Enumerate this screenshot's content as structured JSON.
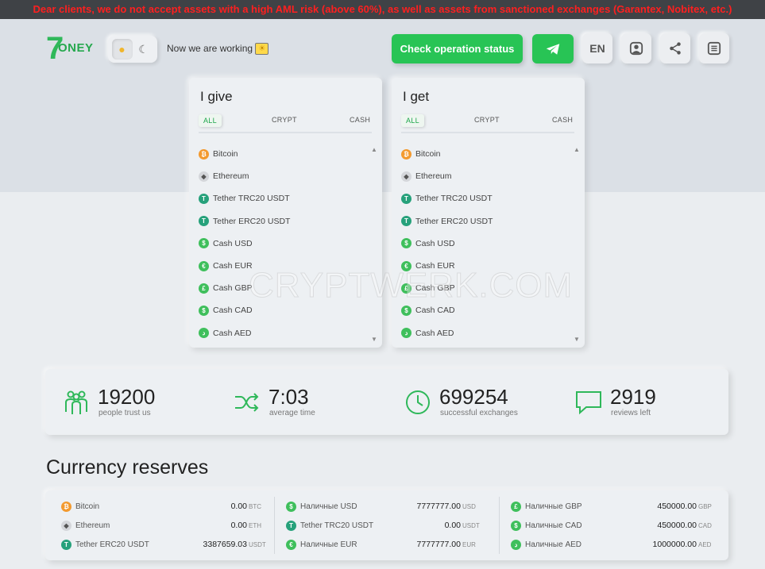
{
  "banner": "Dear clients, we do not accept assets with a high AML risk (above 60%), as well as assets from sanctioned exchanges (Garantex, Nobitex, etc.)",
  "header": {
    "logo_seven": "7",
    "logo_text": "ONEY",
    "working_text": "Now we are working",
    "check_status_label": "Check operation status",
    "lang_label": "EN"
  },
  "give": {
    "title": "I give",
    "tabs": [
      "ALL",
      "CRYPT",
      "CASH"
    ],
    "items": [
      "Bitcoin",
      "Ethereum",
      "Tether TRC20 USDT",
      "Tether ERC20 USDT",
      "Cash USD",
      "Cash EUR",
      "Cash GBP",
      "Cash CAD",
      "Cash AED"
    ]
  },
  "get": {
    "title": "I get",
    "tabs": [
      "ALL",
      "CRYPT",
      "CASH"
    ],
    "items": [
      "Bitcoin",
      "Ethereum",
      "Tether TRC20 USDT",
      "Tether ERC20 USDT",
      "Cash USD",
      "Cash EUR",
      "Cash GBP",
      "Cash CAD",
      "Cash AED"
    ]
  },
  "watermark": "CRYPTWERK.COM",
  "stats": [
    {
      "value": "19200",
      "label": "people trust us"
    },
    {
      "value": "7:03",
      "label": "average time"
    },
    {
      "value": "699254",
      "label": "successful exchanges"
    },
    {
      "value": "2919",
      "label": "reviews left"
    }
  ],
  "reserves": {
    "title": "Currency reserves",
    "columns": [
      [
        {
          "name": "Bitcoin",
          "amount": "0.00",
          "currency": "BTC"
        },
        {
          "name": "Ethereum",
          "amount": "0.00",
          "currency": "ETH"
        },
        {
          "name": "Tether ERC20 USDT",
          "amount": "3387659.03",
          "currency": "USDT"
        }
      ],
      [
        {
          "name": "Наличные USD",
          "amount": "7777777.00",
          "currency": "USD"
        },
        {
          "name": "Tether TRC20 USDT",
          "amount": "0.00",
          "currency": "USDT"
        },
        {
          "name": "Наличные EUR",
          "amount": "7777777.00",
          "currency": "EUR"
        }
      ],
      [
        {
          "name": "Наличные GBP",
          "amount": "450000.00",
          "currency": "GBP"
        },
        {
          "name": "Наличные CAD",
          "amount": "450000.00",
          "currency": "CAD"
        },
        {
          "name": "Наличные AED",
          "amount": "1000000.00",
          "currency": "AED"
        }
      ]
    ]
  },
  "colors": {
    "accent": "#28c455",
    "banner_text": "#ff1f1f",
    "banner_bg": "#3f4246"
  }
}
